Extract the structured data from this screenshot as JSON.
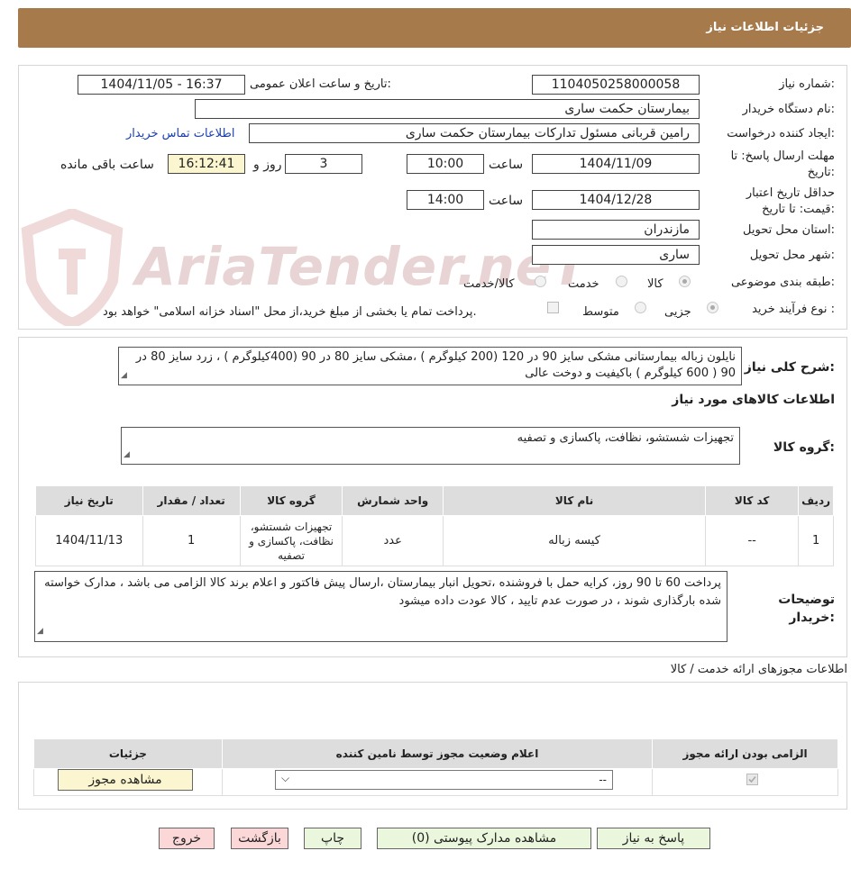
{
  "header": {
    "title": "جزئیات اطلاعات نیاز"
  },
  "watermark": {
    "text": "AriaTender.neT"
  },
  "form": {
    "need_number_label": "شماره نیاز:",
    "need_number": "1104050258000058",
    "announce_label": "تاریخ و ساعت اعلان عمومی:",
    "announce_value": "1404/11/05 - 16:37",
    "buyer_org_label": "نام دستگاه خریدار:",
    "buyer_org": "بیمارستان حکمت ساری",
    "creator_label": "ایجاد کننده درخواست:",
    "creator": "رامین  قربانی مسئول تدارکات بیمارستان حکمت ساری",
    "contact_link": "اطلاعات تماس خریدار",
    "deadline_label": "مهلت ارسال پاسخ: تا تاریخ:",
    "deadline_date": "1404/11/09",
    "time_label": "ساعت",
    "deadline_time": "10:00",
    "days_value": "3",
    "days_label": "روز و",
    "remaining_time": "16:12:41",
    "remaining_label": "ساعت باقی مانده",
    "validity_label": "حداقل تاریخ اعتبار قیمت: تا تاریخ:",
    "validity_date": "1404/12/28",
    "validity_time": "14:00",
    "province_label": "استان محل تحویل:",
    "province": "مازندران",
    "city_label": "شهر محل تحویل:",
    "city": "ساری",
    "category_label": "طبقه بندی موضوعی:",
    "category_options": [
      "کالا",
      "خدمت",
      "کالا/خدمت"
    ],
    "process_label": "نوع فرآیند خرید :",
    "process_options": [
      "جزیی",
      "متوسط"
    ],
    "payment_note": "پرداخت تمام یا بخشی از مبلغ خرید،از محل \"اسناد خزانه اسلامی\" خواهد بود."
  },
  "summary": {
    "label": "شرح کلی نیاز:",
    "text": "نایلون زباله بیمارستانی مشکی سایز 90 در 120 (200 کیلوگرم ) ،مشکی سایز 80 در 90 (400کیلوگرم ) ، زرد سایز 80 در 90 ( 600 کیلوگرم ) باکیفیت و دوخت عالی",
    "goods_info_title": "اطلاعات کالاهای مورد نیاز",
    "group_label": "گروه کالا:",
    "group_value": "تجهیزات شستشو، نظافت، پاکسازی و تصفیه"
  },
  "goods_table": {
    "headers": [
      "ردیف",
      "کد کالا",
      "نام کالا",
      "واحد شمارش",
      "گروه کالا",
      "تعداد / مقدار",
      "تاریخ نیاز"
    ],
    "rows": [
      [
        "1",
        "--",
        "کیسه زباله",
        "عدد",
        "تجهیزات شستشو، نظافت، پاکسازی و تصفیه",
        "1",
        "1404/11/13"
      ]
    ]
  },
  "buyer_notes": {
    "label": "توضیحات خریدار:",
    "text": "پرداخت 60 تا 90 روز، کرایه حمل با فروشنده ،تحویل انبار بیمارستان ،ارسال پیش فاکتور و اعلام برند کالا الزامی می باشد ، مدارک خواسته شده بارگذاری شوند ، در صورت عدم تایید ، کالا عودت داده میشود"
  },
  "permits": {
    "title": "اطلاعات مجوزهای ارائه خدمت / کالا",
    "headers": [
      "الزامی بودن ارائه مجوز",
      "اعلام وضعیت مجوز توسط نامین کننده",
      "جزئیات"
    ],
    "select_value": "--",
    "view_button": "مشاهده مجوز"
  },
  "buttons": {
    "reply": "پاسخ به نیاز",
    "attachments": "مشاهده مدارک پیوستی (0)",
    "print": "چاپ",
    "back": "بازگشت",
    "exit": "خروج"
  },
  "colors": {
    "header": "#a67a4b",
    "yellow": "#fbf6cf",
    "link": "#1a3fb0",
    "back_btn": "#fbd7d7",
    "green_btn": "#eaf7dc"
  }
}
